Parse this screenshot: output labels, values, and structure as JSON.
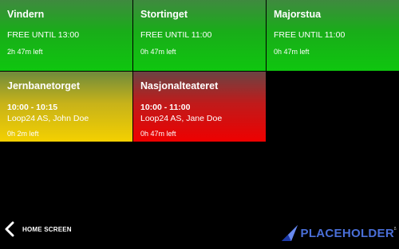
{
  "rooms": [
    {
      "name": "Vindern",
      "status": "FREE UNTIL 13:00",
      "time_left": "2h 47m left"
    },
    {
      "name": "Stortinget",
      "status": "FREE UNTIL 11:00",
      "time_left": "0h 47m left"
    },
    {
      "name": "Majorstua",
      "status": "FREE UNTIL 11:00",
      "time_left": "0h 47m left"
    },
    {
      "name": "Jernbanetorget",
      "time_range": "10:00 - 10:15",
      "organizer": "Loop24 AS, John Doe",
      "time_left": "0h 2m left"
    },
    {
      "name": "Nasjonalteateret",
      "time_range": "10:00 - 11:00",
      "organizer": "Loop24 AS, Jane Doe",
      "time_left": "0h 47m left"
    }
  ],
  "footer": {
    "home_label": "HOME SCREEN"
  },
  "logo": {
    "text": "PLACEHOLDER",
    "tiny_text": "v1"
  },
  "colors": {
    "free": "#11c411",
    "ending": "#f4d000",
    "busy": "#ee0000",
    "logo": "#4a6fd8"
  }
}
